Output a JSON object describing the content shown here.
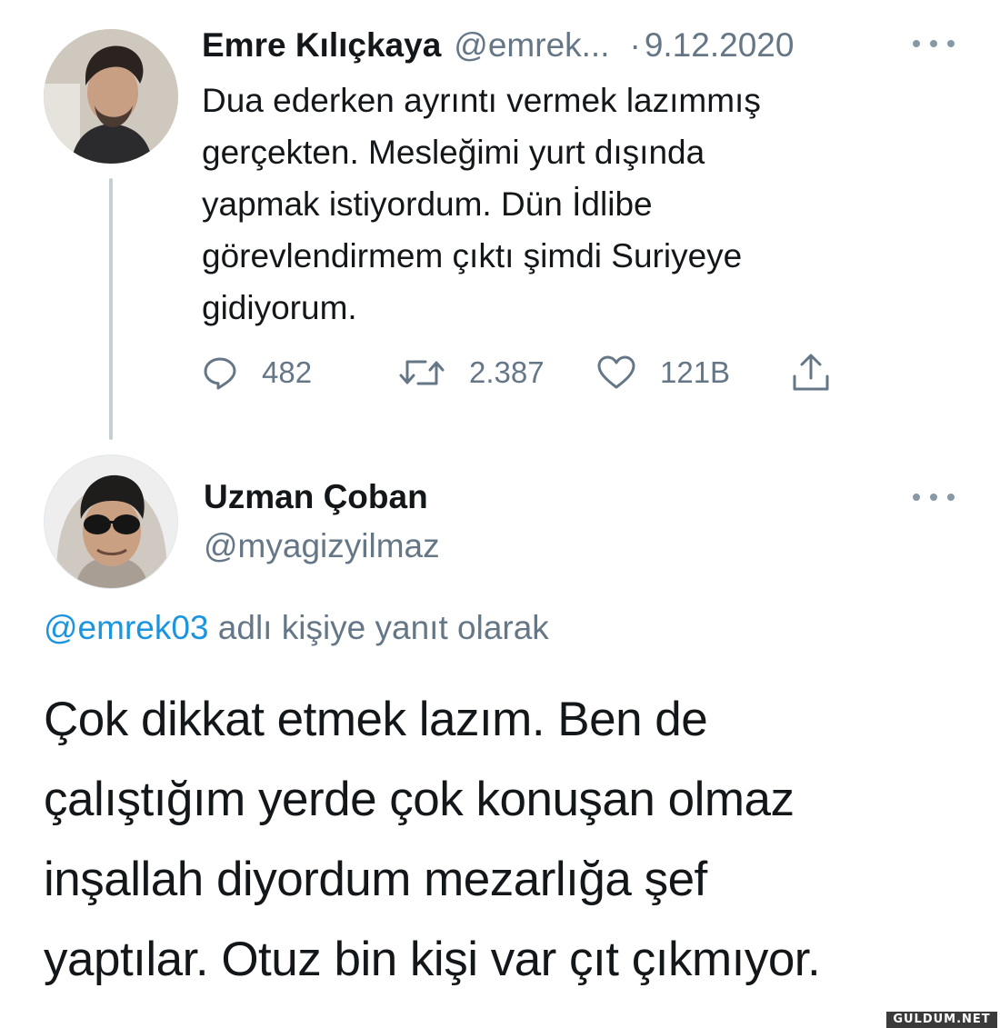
{
  "tweet": {
    "author_name": "Emre Kılıçkaya",
    "author_handle": "@emrek...",
    "separator": "·",
    "date": "9.12.2020",
    "text_lines": [
      "Dua ederken ayrıntı vermek lazımmış",
      "gerçekten. Mesleğimi yurt dışında",
      "yapmak istiyordum. Dün İdlibe",
      "görevlendirmem çıktı şimdi Suriyeye",
      "gidiyorum."
    ],
    "replies": "482",
    "retweets": "2.387",
    "likes": "121B",
    "icons": {
      "reply": "reply-icon",
      "retweet": "retweet-icon",
      "like": "heart-icon",
      "share": "share-icon",
      "more": "more-icon"
    }
  },
  "reply": {
    "author_name": "Uzman Çoban",
    "author_handle": "@myagizyilmaz",
    "reply_mention": "@emrek03",
    "reply_context": "adlı kişiye yanıt olarak",
    "text_lines": [
      "Çok dikkat etmek lazım. Ben de",
      "çalıştığım yerde çok konuşan olmaz",
      "inşallah diyordum mezarlığa şef",
      "yaptılar. Otuz bin kişi var çıt çıkmıyor."
    ]
  },
  "watermark": "GULDUM.NET",
  "colors": {
    "text": "#14171a",
    "secondary": "#657786",
    "link": "#1b95e0",
    "thread_line": "#c4cfd6"
  }
}
